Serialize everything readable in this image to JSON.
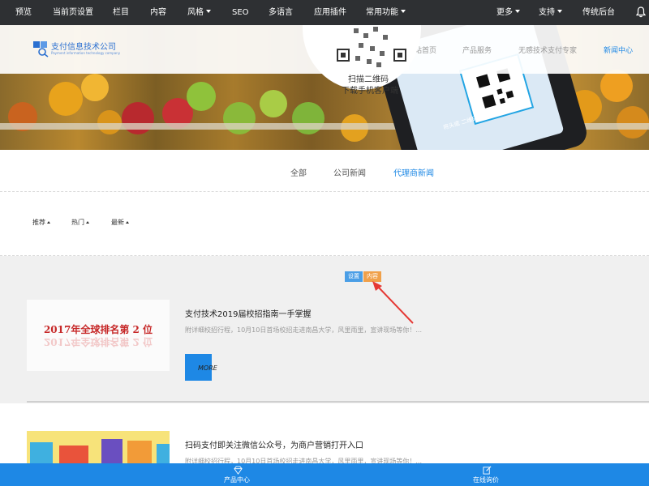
{
  "toolbar": {
    "items": [
      {
        "label": "预览"
      },
      {
        "label": "当前页设置"
      },
      {
        "label": "栏目"
      },
      {
        "label": "内容"
      },
      {
        "label": "风格"
      },
      {
        "label": "SEO"
      },
      {
        "label": "多语言"
      },
      {
        "label": "应用插件"
      },
      {
        "label": "常用功能"
      }
    ],
    "right": [
      {
        "label": "更多"
      },
      {
        "label": "支持"
      },
      {
        "label": "传统后台"
      }
    ]
  },
  "header": {
    "logo_name": "支付信息技术公司",
    "logo_sub": "Payment information technology company",
    "nav": [
      "网站首页",
      "产品服务",
      "无感技术支付专家",
      "新闻中心"
    ],
    "qr_line1": "扫描二维码",
    "qr_line2": "下载手机客户端",
    "phone_caption": "将头或  二维码放入框内"
  },
  "categories": [
    "全部",
    "公司新闻",
    "代理商新闻"
  ],
  "sort": [
    "推荐",
    "热门",
    "最新"
  ],
  "edit_badges": {
    "settings": "设置",
    "content": "内容"
  },
  "articles": [
    {
      "title": "支付技术2019届校招指南一手掌握",
      "summary": "附详细校招行程，10月10日首场校招走进南昌大学，风里雨里，宣讲现场等你！...",
      "thumb_text": "2017年全球排名第 2 位",
      "more": "MORE"
    },
    {
      "title": "扫码支付即关注微信公众号，为商户营销打开入口",
      "summary": "附详细校招行程，10月10日首场校招走进南昌大学，风里雨里，宣讲现场等你！..."
    }
  ],
  "bottom_bar": {
    "products": "产品中心",
    "inquiry": "在线询价"
  },
  "colors": {
    "toolbar": "#2e3033",
    "accent": "#1e88e5",
    "badge_settings": "#4a9ee6",
    "badge_content": "#f0a04a",
    "hover_row": "#f0f0f0"
  }
}
